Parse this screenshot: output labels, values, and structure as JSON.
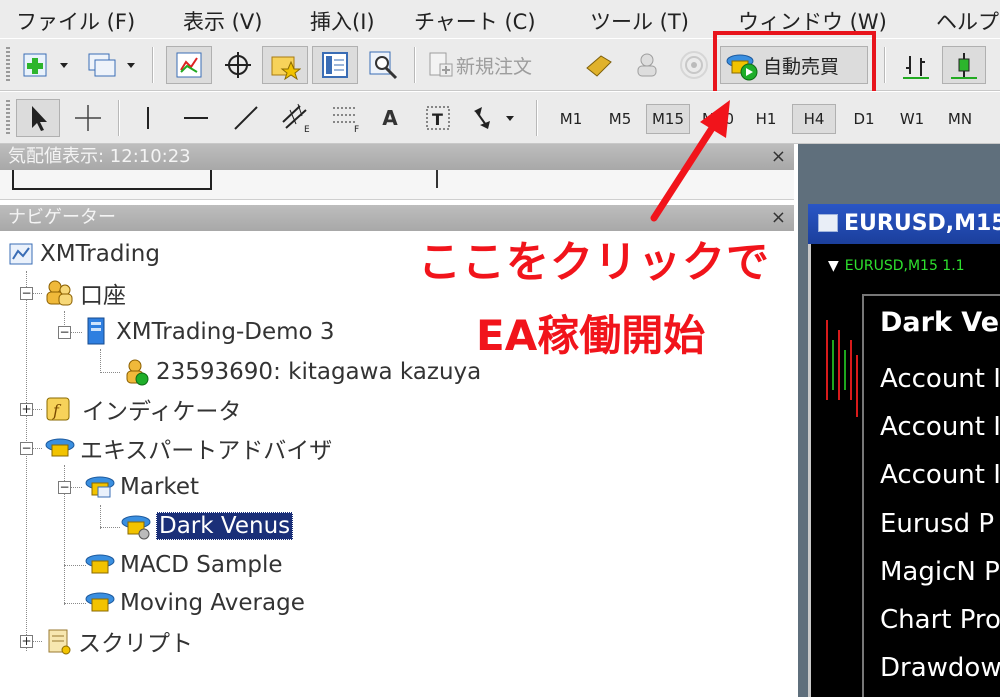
{
  "menubar": {
    "items": [
      "ファイル (F)",
      "表示 (V)",
      "挿入(I)",
      "チャート (C)",
      "ツール (T)",
      "ウィンドウ (W)",
      "ヘルプ"
    ]
  },
  "toolbar1": {
    "new_order_label": "新規注文",
    "auto_trading_label": "自動売買"
  },
  "toolbar2": {
    "text_tool_label": "A",
    "timeframes": [
      "M1",
      "M5",
      "M15",
      "M30",
      "H1",
      "H4",
      "D1",
      "W1",
      "MN"
    ],
    "pressed_timeframes": [
      "M15",
      "H4"
    ]
  },
  "market_watch": {
    "title": "気配値表示: 12:10:23",
    "close_label": "×"
  },
  "navigator": {
    "title": "ナビゲーター",
    "close_label": "×",
    "tree": {
      "root": "XMTrading",
      "accounts": "口座",
      "server": "XMTrading-Demo 3",
      "account": "23593690: kitagawa kazuya",
      "indicators": "インディケータ",
      "experts": "エキスパートアドバイザ",
      "market": "Market",
      "dark_venus": "Dark Venus",
      "macd": "MACD Sample",
      "moving_average": "Moving Average",
      "scripts": "スクリプト"
    }
  },
  "chart": {
    "window_title": "EURUSD,M15",
    "header": "EURUSD,M15  1.1",
    "info_title": "Dark Ve",
    "info_lines": [
      "Account I",
      "Account I",
      "Account I",
      "Eurusd P",
      "MagicN P",
      "Chart Pro",
      "Drawdow"
    ]
  },
  "annotation": {
    "line1": "ここをクリックで",
    "line2": "EA稼働開始",
    "color": "#f1141b"
  }
}
